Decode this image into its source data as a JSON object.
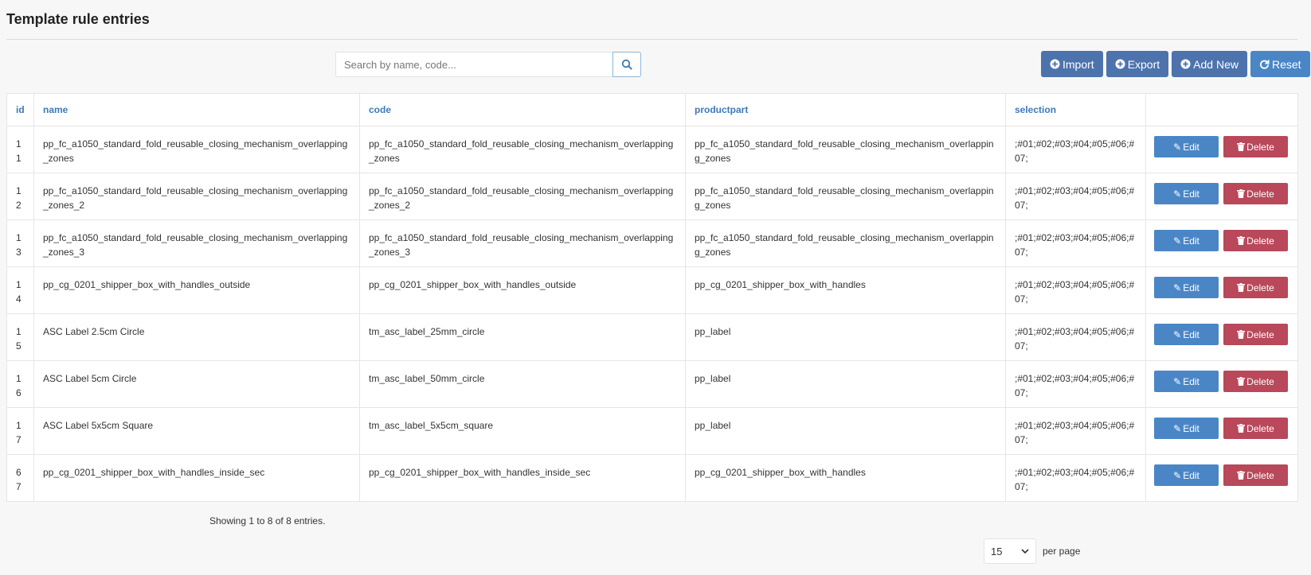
{
  "page": {
    "title": "Template rule entries"
  },
  "search": {
    "placeholder": "Search by name, code..."
  },
  "toolbar": {
    "import_label": "Import",
    "export_label": "Export",
    "add_new_label": "Add New",
    "reset_label": "Reset"
  },
  "table": {
    "headers": [
      "id",
      "name",
      "code",
      "productpart",
      "selection"
    ],
    "edit_label": "Edit",
    "delete_label": "Delete",
    "rows": [
      {
        "id": "11",
        "name": "pp_fc_a1050_standard_fold_reusable_closing_mechanism_overlapping_zones",
        "code": "pp_fc_a1050_standard_fold_reusable_closing_mechanism_overlapping_zones",
        "productpart": "pp_fc_a1050_standard_fold_reusable_closing_mechanism_overlapping_zones",
        "selection": ";#01;#02;#03;#04;#05;#06;#07;"
      },
      {
        "id": "12",
        "name": "pp_fc_a1050_standard_fold_reusable_closing_mechanism_overlapping_zones_2",
        "code": "pp_fc_a1050_standard_fold_reusable_closing_mechanism_overlapping_zones_2",
        "productpart": "pp_fc_a1050_standard_fold_reusable_closing_mechanism_overlapping_zones",
        "selection": ";#01;#02;#03;#04;#05;#06;#07;"
      },
      {
        "id": "13",
        "name": "pp_fc_a1050_standard_fold_reusable_closing_mechanism_overlapping_zones_3",
        "code": "pp_fc_a1050_standard_fold_reusable_closing_mechanism_overlapping_zones_3",
        "productpart": "pp_fc_a1050_standard_fold_reusable_closing_mechanism_overlapping_zones",
        "selection": ";#01;#02;#03;#04;#05;#06;#07;"
      },
      {
        "id": "14",
        "name": "pp_cg_0201_shipper_box_with_handles_outside",
        "code": "pp_cg_0201_shipper_box_with_handles_outside",
        "productpart": "pp_cg_0201_shipper_box_with_handles",
        "selection": ";#01;#02;#03;#04;#05;#06;#07;"
      },
      {
        "id": "15",
        "name": "ASC Label 2.5cm Circle",
        "code": "tm_asc_label_25mm_circle",
        "productpart": "pp_label",
        "selection": ";#01;#02;#03;#04;#05;#06;#07;"
      },
      {
        "id": "16",
        "name": "ASC Label 5cm Circle",
        "code": "tm_asc_label_50mm_circle",
        "productpart": "pp_label",
        "selection": ";#01;#02;#03;#04;#05;#06;#07;"
      },
      {
        "id": "17",
        "name": "ASC Label 5x5cm Square",
        "code": "tm_asc_label_5x5cm_square",
        "productpart": "pp_label",
        "selection": ";#01;#02;#03;#04;#05;#06;#07;"
      },
      {
        "id": "67",
        "name": "pp_cg_0201_shipper_box_with_handles_inside_sec",
        "code": "pp_cg_0201_shipper_box_with_handles_inside_sec",
        "productpart": "pp_cg_0201_shipper_box_with_handles",
        "selection": ";#01;#02;#03;#04;#05;#06;#07;"
      }
    ]
  },
  "footer": {
    "info": "Showing 1 to 8 of 8 entries.",
    "per_page_value": "15",
    "per_page_label": "per page"
  },
  "colors": {
    "header_link": "#3d7ab8",
    "primary_dark": "#4d73ad",
    "primary": "#4a86c6",
    "danger": "#b8485a"
  }
}
